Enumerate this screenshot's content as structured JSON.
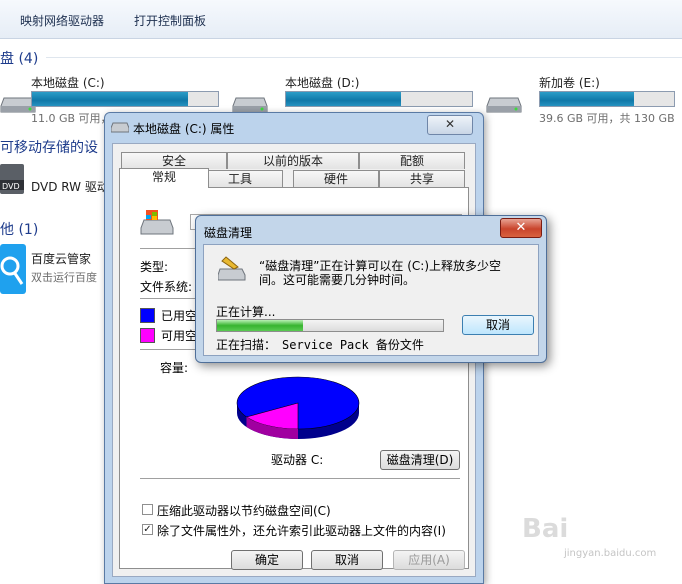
{
  "toolbar": {
    "map_drive": "映射网络驱动器",
    "control_panel": "打开控制面板"
  },
  "sections": {
    "hdd": "盘 (4)",
    "removable": "可移动存储的设",
    "other": "他 (1)"
  },
  "drives": [
    {
      "name": "本地磁盘 (C:)",
      "info": "11.0 GB 可用，",
      "used_fraction": 0.84
    },
    {
      "name": "本地磁盘 (D:)",
      "info": "",
      "used_fraction": 0.62
    },
    {
      "name": "新加卷 (E:)",
      "info": "39.6 GB 可用，共 130 GB",
      "used_fraction": 0.7
    }
  ],
  "dvd": {
    "name": "DVD RW 驱动",
    "icon_text": "DVD"
  },
  "app": {
    "name": "百度云管家",
    "desc": "双击运行百度"
  },
  "props": {
    "title": "本地磁盘 (C:) 属性",
    "close": "✕",
    "tabs_row1": [
      "安全",
      "以前的版本",
      "配额"
    ],
    "tabs_row2": [
      "常规",
      "工具",
      "硬件",
      "共享"
    ],
    "type_label": "类型:",
    "fs_label": "文件系统:",
    "used_label": "已用空间",
    "free_label": "可用空间",
    "capacity_label": "容量:",
    "drive_label": "驱动器 C:",
    "cleanup_button": "磁盘清理(D)",
    "compress_label": "压缩此驱动器以节约磁盘空间(C)",
    "index_label": "除了文件属性外，还允许索引此驱动器上文件的内容(I)",
    "ok": "确定",
    "cancel": "取消",
    "apply": "应用(A)",
    "used_fraction": 0.84,
    "colors": {
      "used": "#0000ff",
      "free": "#ff00ff"
    }
  },
  "cleanup": {
    "title": "磁盘清理",
    "close": "✕",
    "line1": "“磁盘清理”正在计算可以在 (C:)上释放多少空",
    "line2": "间。这可能需要几分钟时间。",
    "calculating": "正在计算...",
    "cancel": "取消",
    "scanning_label": "正在扫描：",
    "scanning_item": "Service Pack 备份文件",
    "progress_fraction": 0.38
  },
  "watermark": {
    "main": "Bai",
    "sub": "jingyan.baidu.com"
  }
}
